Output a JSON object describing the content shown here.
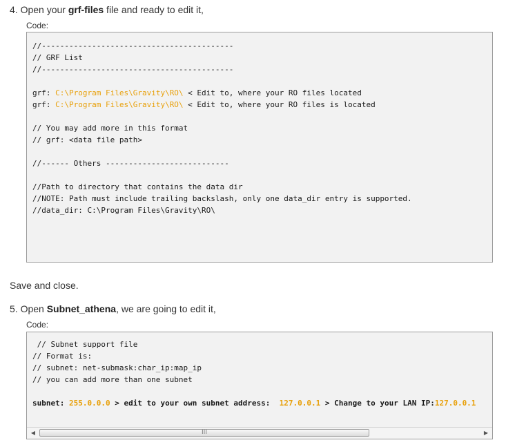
{
  "step4": {
    "prefix": "4. Open your ",
    "bold": "grf-files",
    "suffix": " file and ready to edit it,"
  },
  "code_label_1": "Code:",
  "code1": {
    "lines": [
      {
        "parts": [
          {
            "t": "//------------------------------------------"
          }
        ]
      },
      {
        "parts": [
          {
            "t": "// GRF List"
          }
        ]
      },
      {
        "parts": [
          {
            "t": "//------------------------------------------"
          }
        ]
      },
      {
        "parts": [
          {
            "t": ""
          }
        ]
      },
      {
        "parts": [
          {
            "t": "grf: "
          },
          {
            "t": "C:\\Program Files\\Gravity\\RO\\",
            "c": "hl"
          },
          {
            "t": " < Edit to, where your RO files located"
          }
        ]
      },
      {
        "parts": [
          {
            "t": "grf: "
          },
          {
            "t": "C:\\Program Files\\Gravity\\RO\\",
            "c": "hl"
          },
          {
            "t": " < Edit to, where your RO files is located"
          }
        ]
      },
      {
        "parts": [
          {
            "t": ""
          }
        ]
      },
      {
        "parts": [
          {
            "t": "// You may add more in this format"
          }
        ]
      },
      {
        "parts": [
          {
            "t": "// grf: <data file path>"
          }
        ]
      },
      {
        "parts": [
          {
            "t": ""
          }
        ]
      },
      {
        "parts": [
          {
            "t": "//------ Others ---------------------------"
          }
        ]
      },
      {
        "parts": [
          {
            "t": ""
          }
        ]
      },
      {
        "parts": [
          {
            "t": "//Path to directory that contains the data dir"
          }
        ]
      },
      {
        "parts": [
          {
            "t": "//NOTE: Path must include trailing backslash, only one data_dir entry is supported."
          }
        ]
      },
      {
        "parts": [
          {
            "t": "//data_dir: C:\\Program Files\\Gravity\\RO\\"
          }
        ]
      }
    ]
  },
  "save_close": "Save and close.",
  "step5": {
    "prefix": "5. Open ",
    "bold": "Subnet_athena",
    "suffix": ", we are going to edit it,"
  },
  "code_label_2": "Code:",
  "code2": {
    "lines": [
      {
        "parts": [
          {
            "t": " // Subnet support file"
          }
        ]
      },
      {
        "parts": [
          {
            "t": "// Format is:"
          }
        ]
      },
      {
        "parts": [
          {
            "t": "// subnet: net-submask:char_ip:map_ip"
          }
        ]
      },
      {
        "parts": [
          {
            "t": "// you can add more than one subnet"
          }
        ]
      },
      {
        "parts": [
          {
            "t": ""
          }
        ]
      },
      {
        "parts": [
          {
            "t": "subnet: ",
            "c": "bold"
          },
          {
            "t": "255.0.0.0",
            "c": "hl bold"
          },
          {
            "t": " > ",
            "c": "bold"
          },
          {
            "t": "edit to your own subnet address:",
            "c": "bold"
          },
          {
            "t": "  "
          },
          {
            "t": "127.0.0.1",
            "c": "hl bold"
          },
          {
            "t": " > ",
            "c": "bold"
          },
          {
            "t": "Change to your LAN IP:",
            "c": "bold"
          },
          {
            "t": "127.0.0.1",
            "c": "hl bold"
          }
        ]
      }
    ]
  },
  "scrollbar": {
    "left_arrow": "◀",
    "grip": "III",
    "right_arrow": "▶"
  }
}
